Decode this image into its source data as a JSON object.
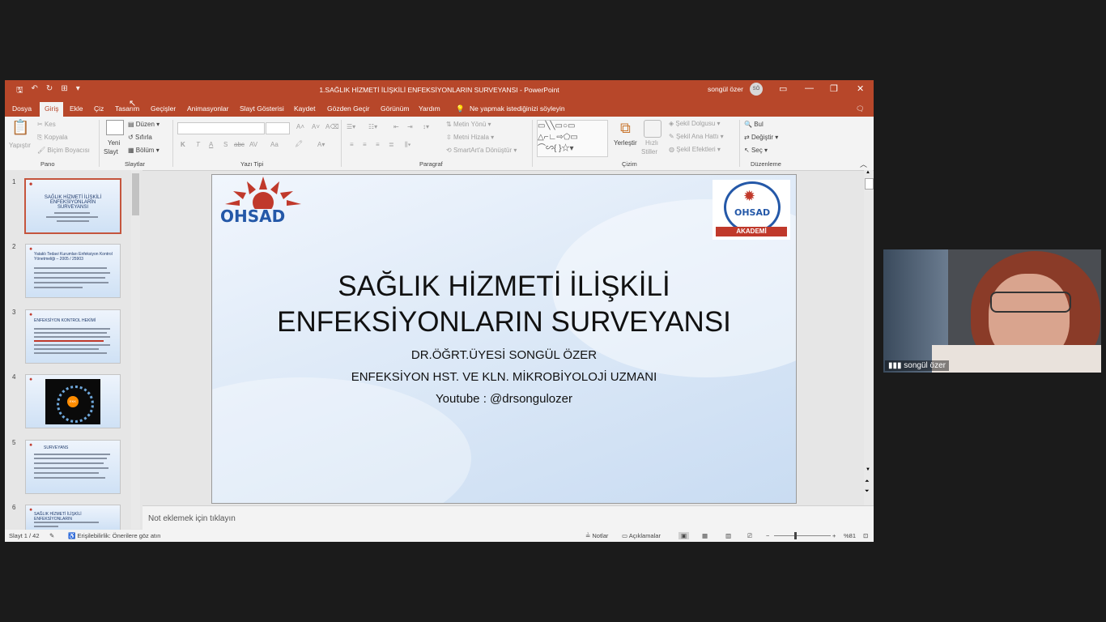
{
  "window": {
    "title": "1.SAĞLIK HİZMETİ İLİŞKİLİ ENFEKSİYONLARIN SURVEYANSI  -  PowerPoint",
    "user": "songül özer",
    "initials": "SÖ"
  },
  "tabs": [
    "Dosya",
    "Giriş",
    "Ekle",
    "Çiz",
    "Tasarım",
    "Geçişler",
    "Animasyonlar",
    "Slayt Gösterisi",
    "Kaydet",
    "Gözden Geçir",
    "Görünüm",
    "Yardım"
  ],
  "tell_me": "Ne yapmak istediğinizi söyleyin",
  "ribbon": {
    "pano": {
      "paste": "Yapıştır",
      "cut": "Kes",
      "copy": "Kopyala",
      "format": "Biçim Boyacısı",
      "label": "Pano"
    },
    "slaytlar": {
      "new1": "Yeni",
      "new2": "Slayt",
      "layout": "Düzen",
      "reset": "Sıfırla",
      "section": "Bölüm",
      "label": "Slaytlar"
    },
    "yazitipi": {
      "bold": "K",
      "italic": "T",
      "underline": "A",
      "shadow": "S",
      "strike": "abc",
      "spacing": "AV",
      "case": "Aa",
      "label": "Yazı Tipi"
    },
    "paragraf": {
      "dir": "Metin Yönü",
      "align": "Metni Hizala",
      "smartart": "SmartArt'a Dönüştür",
      "label": "Paragraf"
    },
    "cizim": {
      "arrange": "Yerleştir",
      "quick1": "Hızlı",
      "quick2": "Stiller",
      "fill": "Şekil Dolgusu",
      "outline": "Şekil Ana Hattı",
      "effects": "Şekil Efektleri",
      "label": "Çizim"
    },
    "duzenleme": {
      "find": "Bul",
      "replace": "Değiştir",
      "select": "Seç",
      "label": "Düzenleme"
    }
  },
  "thumbnails": [
    {
      "num": "1",
      "title": "SAĞLIK HİZMETİ İLİŞKİLİ ENFEKSİYONLARIN SURVEYANSI"
    },
    {
      "num": "2",
      "title": "Yataklı Tedavi Kurumları Enfeksiyon Kontrol Yönetmeliği – 2005 / 25903"
    },
    {
      "num": "3",
      "title": "ENFEKSİYON KONTROL HEKİMİ"
    },
    {
      "num": "4",
      "title": "EKK"
    },
    {
      "num": "5",
      "title": "SURVEYANS"
    },
    {
      "num": "6",
      "title": "SAĞLIK HİZMETİ İLİŞKİLİ ENFEKSİYONLARIN"
    }
  ],
  "slide": {
    "logo_left": "OHSAD",
    "logo_right": "OHSAD",
    "logo_right_band": "AKADEMİ",
    "title_line1": "SAĞLIK HİZMETİ İLİŞKİLİ",
    "title_line2": "ENFEKSİYONLARIN SURVEYANSI",
    "author": "DR.ÖĞRT.ÜYESİ SONGÜL ÖZER",
    "role": "ENFEKSİYON HST. VE KLN.  MİKROBİYOLOJİ UZMANI",
    "youtube": "Youtube : @drsongulozer"
  },
  "notes_placeholder": "Not eklemek için tıklayın",
  "status": {
    "slide": "Slayt 1 / 42",
    "access": "Erişilebilirlik: Önerilere göz atın",
    "notes": "Notlar",
    "comments": "Açıklamalar",
    "zoom": "%81"
  },
  "video": {
    "name": "songül özer"
  },
  "colors": {
    "accent": "#b7472a",
    "slide_bg": "#dce9f8"
  }
}
